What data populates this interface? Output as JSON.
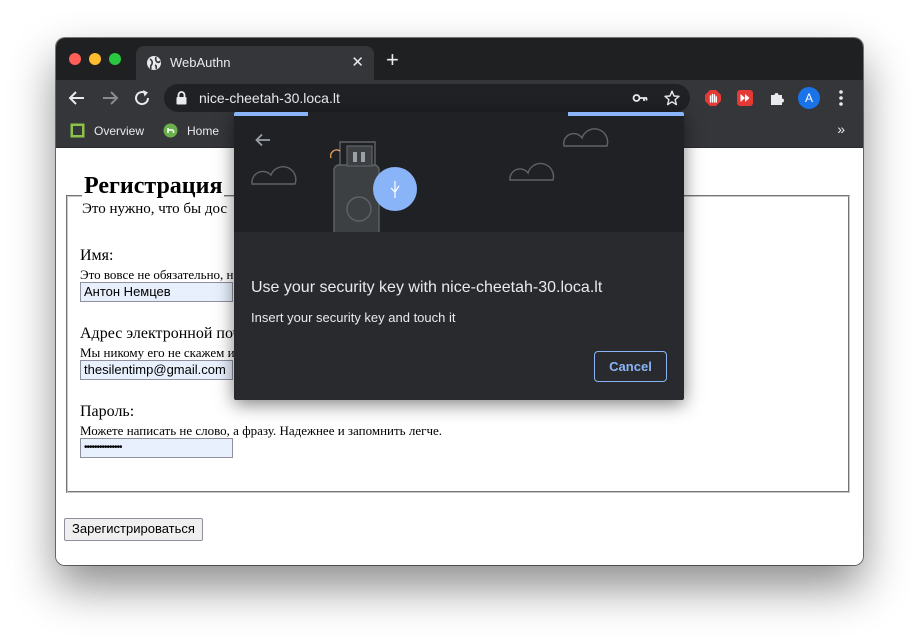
{
  "browser": {
    "tab": {
      "title": "WebAuthn",
      "close_glyph": "✕"
    },
    "new_tab_glyph": "+",
    "address_bar": {
      "url": "nice-cheetah-30.loca.lt"
    },
    "profile_initial": "A",
    "bookmarks": [
      {
        "label": "Overview",
        "icon": "overview-icon"
      },
      {
        "label": "Home",
        "icon": "home-icon"
      }
    ],
    "bookmarks_overflow_glyph": "»"
  },
  "page": {
    "legend": "Регистрация",
    "intro": "Это нужно, что бы дос",
    "fields": [
      {
        "label": "Имя:",
        "hint": "Это вовсе не обязательно, н",
        "value": "Антон Немцев"
      },
      {
        "label": "Адрес электронной поч",
        "hint": "Мы никому его не скажем и",
        "value": "thesilentimp@gmail.com"
      },
      {
        "label": "Пароль:",
        "hint": "Можете написать не слово, а фразу. Надежнее и запомнить легче.",
        "value": "•••••••••••••••"
      }
    ],
    "submit_label": "Зарегистрироваться"
  },
  "dialog": {
    "title": "Use your security key with nice-cheetah-30.loca.lt",
    "description": "Insert your security key and touch it",
    "cancel_label": "Cancel",
    "progress_fraction": 0.33
  },
  "colors": {
    "tab_strip": "#1f2022",
    "toolbar": "#35363a",
    "dialog_bg": "#292a2d",
    "accent": "#8ab4f8"
  }
}
